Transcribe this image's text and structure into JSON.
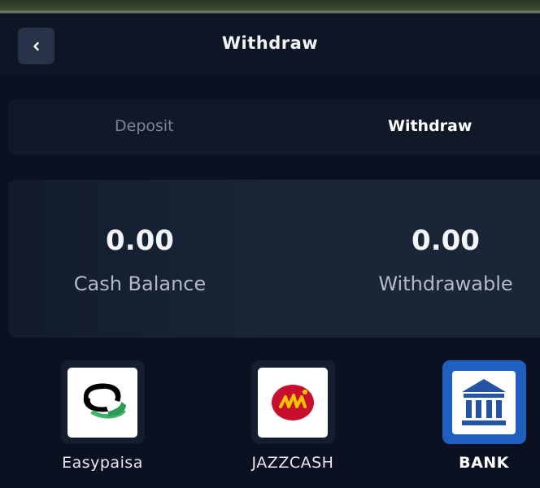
{
  "header": {
    "title": "Withdraw"
  },
  "tabs": [
    {
      "label": "Deposit",
      "active": false
    },
    {
      "label": "Withdraw",
      "active": true
    }
  ],
  "balance": {
    "cash_value": "0.00",
    "cash_label": "Cash Balance",
    "withdrawable_value": "0.00",
    "withdrawable_label": "Withdrawable"
  },
  "methods": [
    {
      "label": "Easypaisa",
      "icon": "easypaisa-logo-icon",
      "selected": false
    },
    {
      "label": "JAZZCASH",
      "icon": "jazzcash-logo-icon",
      "selected": false
    },
    {
      "label": "BANK",
      "icon": "bank-icon",
      "selected": true
    }
  ],
  "colors": {
    "background": "#0b1120",
    "card": "#1a2638",
    "selected_method": "#1e5fbf",
    "easypaisa_green": "#3fb36a",
    "jazz_red": "#c8102e",
    "jazz_yellow": "#f5c400"
  }
}
